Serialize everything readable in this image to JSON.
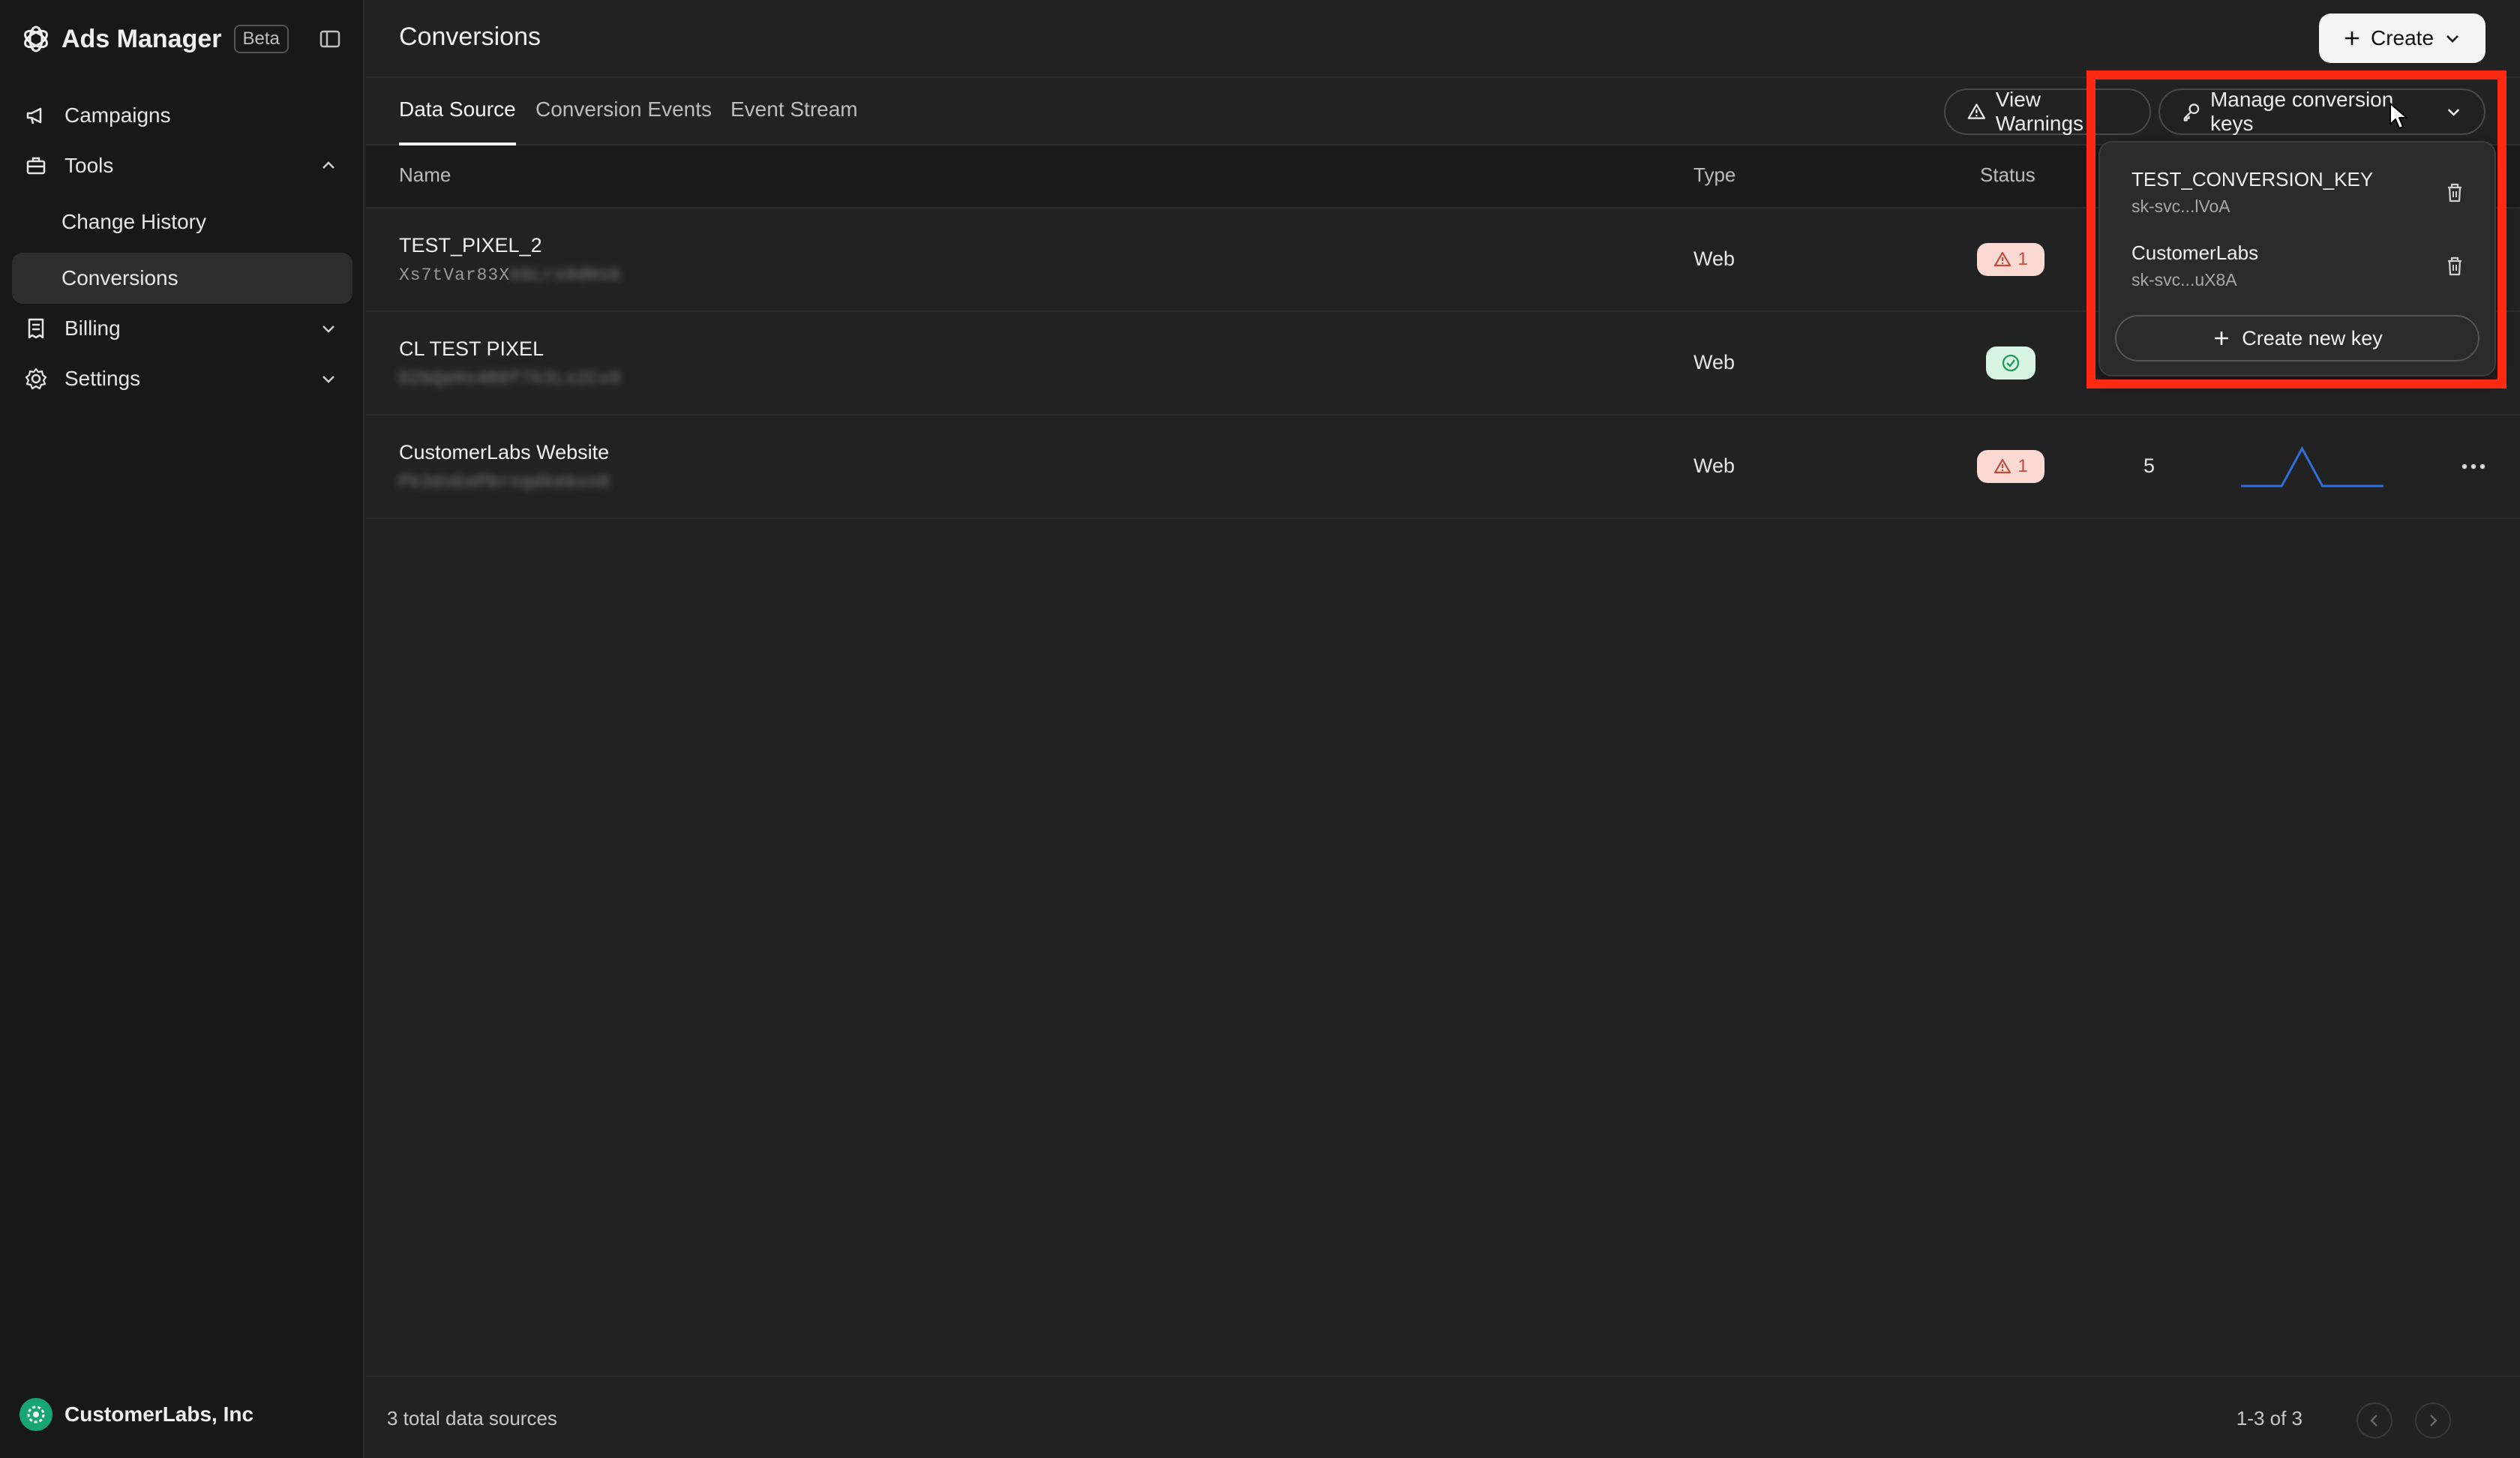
{
  "sidebar": {
    "brand": "Ads Manager",
    "badge": "Beta",
    "items": {
      "campaigns": "Campaigns",
      "tools": "Tools",
      "change_history": "Change History",
      "conversions": "Conversions",
      "billing": "Billing",
      "settings": "Settings"
    },
    "org_name": "CustomerLabs, Inc"
  },
  "header": {
    "title": "Conversions",
    "create_label": "Create"
  },
  "tabs": [
    "Data Source",
    "Conversion Events",
    "Event Stream"
  ],
  "toolbar": {
    "view_warnings": "View Warnings",
    "manage_keys": "Manage conversion keys"
  },
  "table": {
    "columns": {
      "name": "Name",
      "type": "Type",
      "status": "Status"
    },
    "rows": [
      {
        "name": "TEST_PIXEL_2",
        "id_visible": "Xs7tVar83X",
        "id_blurred": "kbLrs9dHs6",
        "type": "Web",
        "status": "warning",
        "warnings": "1",
        "count": "",
        "sparkline": false
      },
      {
        "name": "CL TEST PIXEL",
        "id_visible": "",
        "id_blurred": "D2bQeHs4R8f7k3Ls2Cx9",
        "type": "Web",
        "status": "ok",
        "warnings": "",
        "count": "",
        "sparkline": false
      },
      {
        "name": "CustomerLabs Website",
        "id_visible": "",
        "id_blurred": "Pk3dsEePbrnqdkebxn8",
        "type": "Web",
        "status": "warning",
        "warnings": "1",
        "count": "5",
        "sparkline": true
      }
    ]
  },
  "sparkline_values": [
    0,
    0,
    0,
    1,
    0,
    0,
    0,
    0
  ],
  "footer": {
    "total": "3 total data sources",
    "page_info": "1-3 of 3"
  },
  "dropdown": {
    "keys": [
      {
        "name": "TEST_CONVERSION_KEY",
        "value": "sk-svc...lVoA"
      },
      {
        "name": "CustomerLabs",
        "value": "sk-svc...uX8A"
      }
    ],
    "create_label": "Create new key"
  },
  "colors": {
    "background": "#222222",
    "sidebar": "#181818",
    "warning_bg": "#f9d9d1",
    "warning_fg": "#c24a3a",
    "ok_bg": "#d8f5e3",
    "ok_fg": "#1e9a55",
    "highlight": "#ff2a12",
    "spark": "#2f6fd6"
  }
}
